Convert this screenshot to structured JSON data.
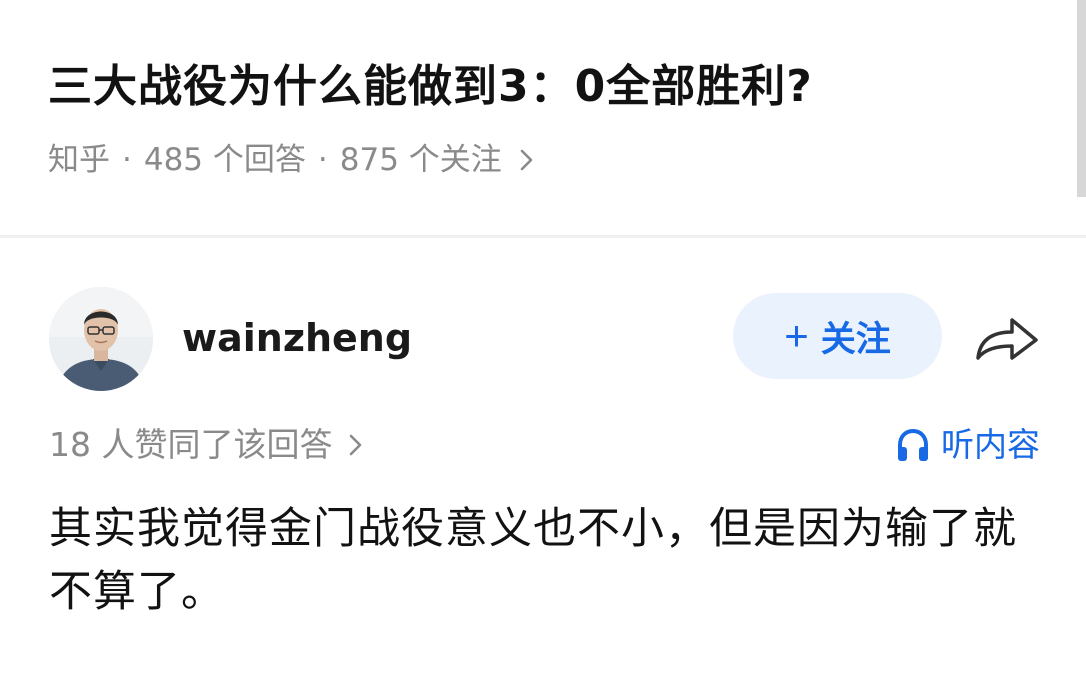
{
  "question": {
    "title": "三大战役为什么能做到3：0全部胜利?",
    "source": "知乎",
    "separator": "·",
    "answers": "485 个回答",
    "followers": "875 个关注"
  },
  "answer": {
    "author": "wainzheng",
    "follow_button": {
      "plus": "+",
      "label": "关注"
    },
    "votes_text": "18 人赞同了该回答",
    "listen_label": "听内容",
    "content": "其实我觉得金门战役意义也不小，但是因为输了就不算了。"
  },
  "icons": {
    "meta_chevron": "chevron-right-icon",
    "votes_chevron": "chevron-right-icon",
    "share": "share-arrow-icon",
    "listen": "headphones-icon"
  },
  "colors": {
    "accent": "#1769e6",
    "follow_bg": "#eaf2fd",
    "title": "#121212",
    "muted": "#8a8a8a",
    "divider": "#f0f0f0"
  }
}
